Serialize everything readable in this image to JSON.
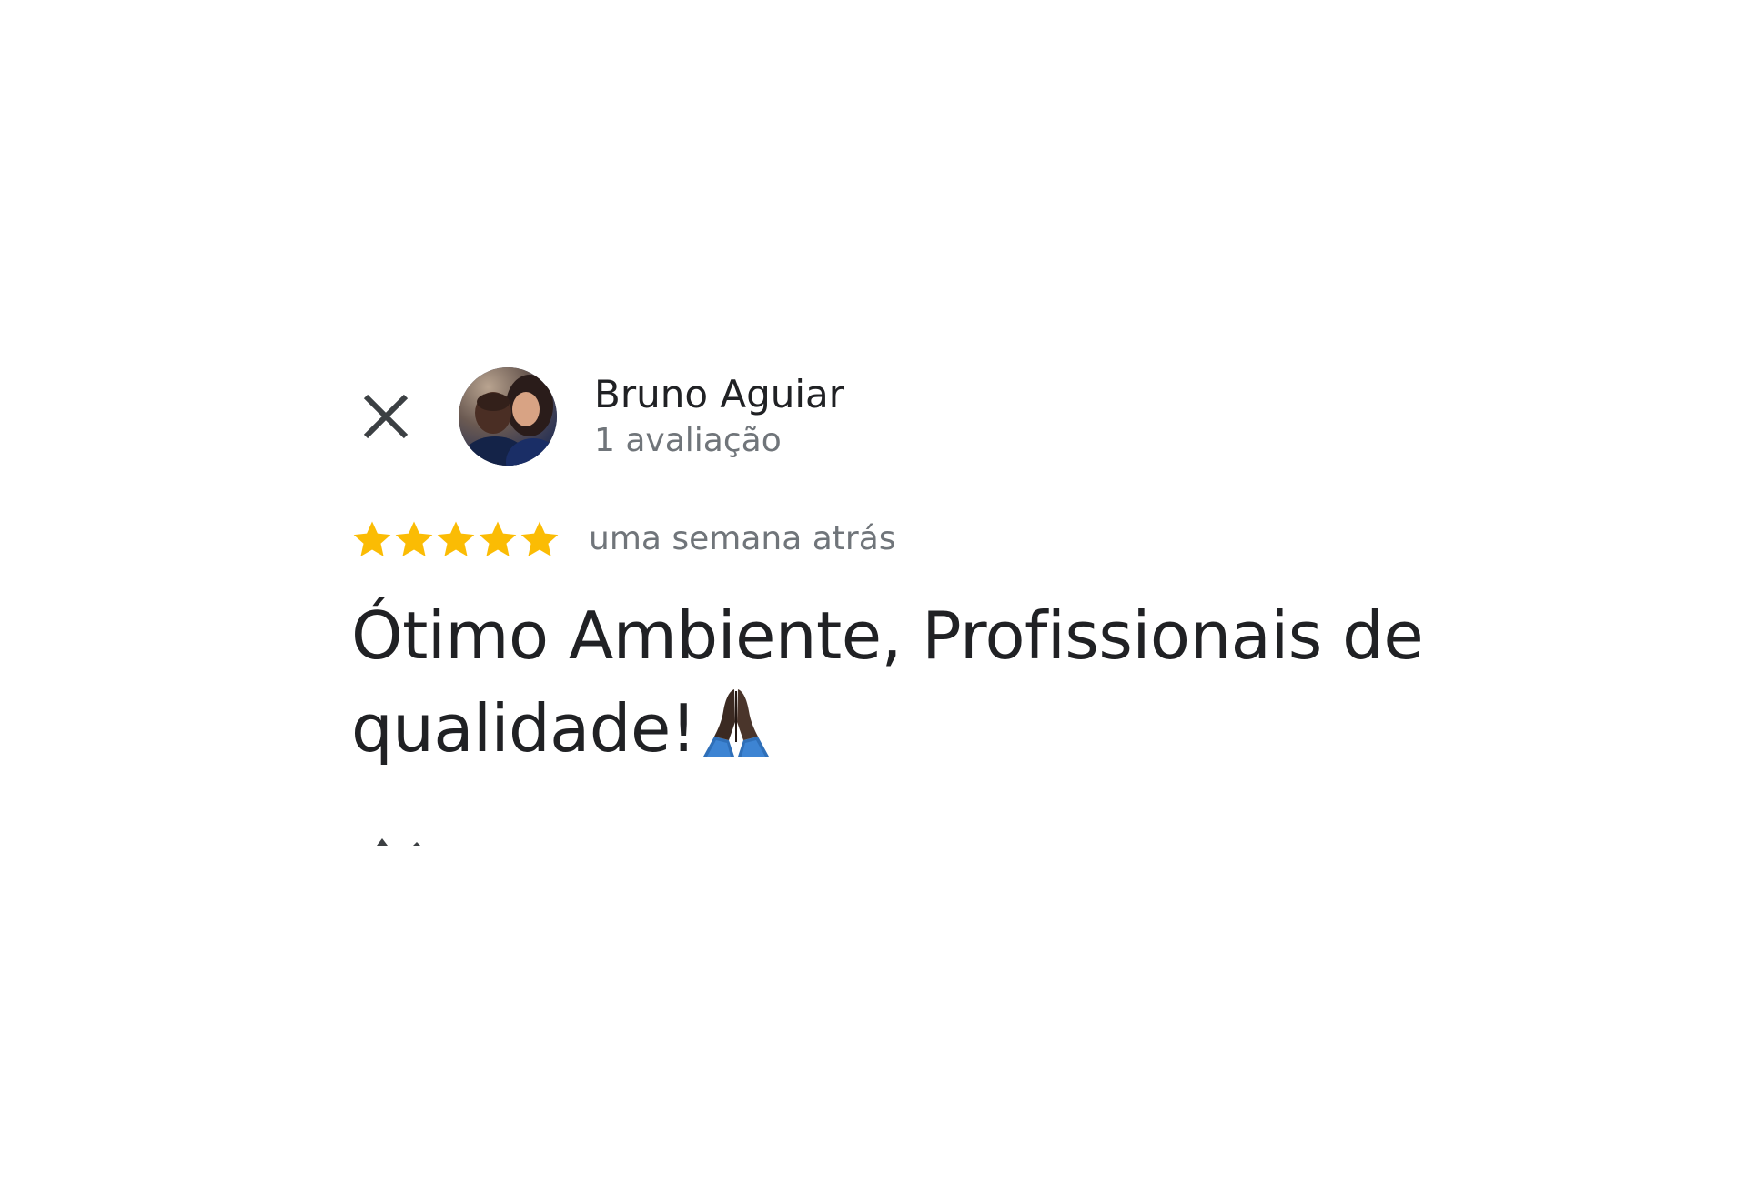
{
  "reviewer": {
    "name": "Bruno Aguiar",
    "review_count": "1 avaliação",
    "avatar_icon": "profile-photo"
  },
  "header": {
    "close_icon": "close-icon"
  },
  "rating": {
    "stars_filled": 5,
    "stars_total": 5,
    "star_color": "#fbbc04",
    "date": "uma semana atrás"
  },
  "review": {
    "text": "Ótimo Ambiente, Profissionais de qualidade!",
    "emoji_icon": "folded-hands-icon"
  },
  "colors": {
    "text_primary": "#202124",
    "text_secondary": "#70757a",
    "icon": "#3c4043",
    "background": "#ffffff"
  }
}
